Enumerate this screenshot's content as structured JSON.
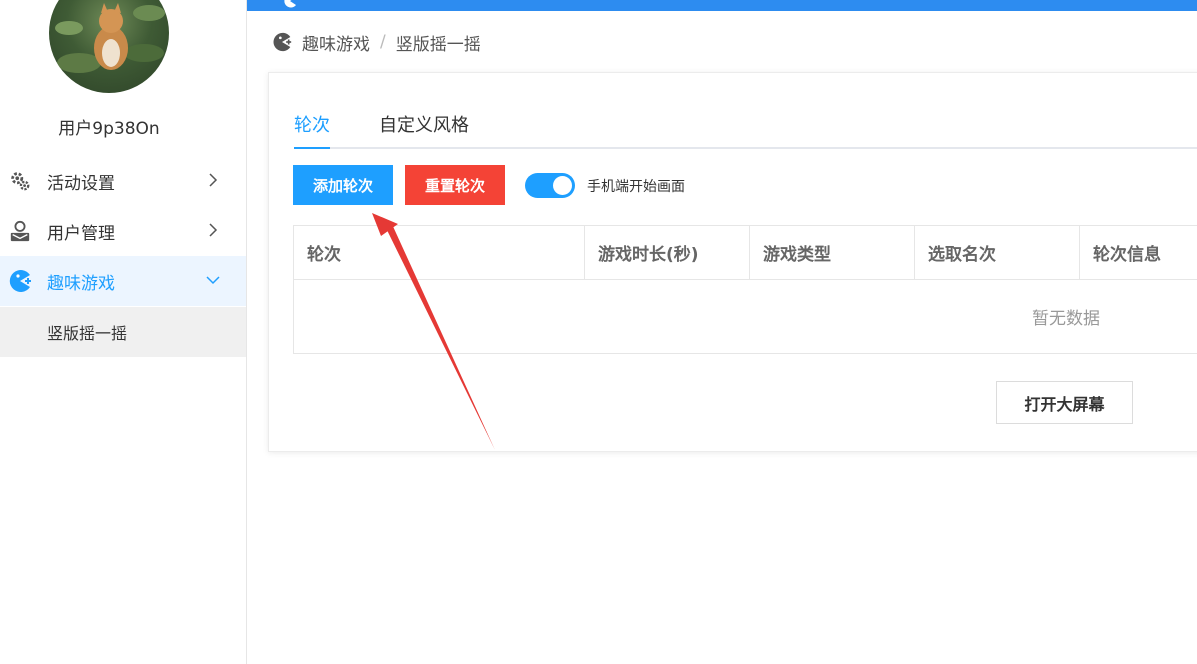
{
  "sidebar": {
    "username": "用户9p38On",
    "items": [
      {
        "label": "活动设置",
        "icon": "gears-icon",
        "expanded": false
      },
      {
        "label": "用户管理",
        "icon": "user-icon",
        "expanded": false
      },
      {
        "label": "趣味游戏",
        "icon": "pacman-icon",
        "expanded": true
      }
    ],
    "submenu": [
      {
        "label": "竖版摇一摇"
      }
    ]
  },
  "breadcrumb": {
    "items": [
      "趣味游戏",
      "竖版摇一摇"
    ]
  },
  "tabs": [
    {
      "label": "轮次",
      "active": true
    },
    {
      "label": "自定义风格",
      "active": false
    }
  ],
  "toolbar": {
    "add_label": "添加轮次",
    "reset_label": "重置轮次",
    "switch_label": "手机端开始画面",
    "switch_on": true
  },
  "table": {
    "columns": [
      "轮次",
      "游戏时长(秒)",
      "游戏类型",
      "选取名次",
      "轮次信息"
    ],
    "empty_text": "暂无数据"
  },
  "footer": {
    "open_screen_label": "打开大屏幕"
  },
  "colors": {
    "accent": "#1e9fff",
    "danger": "#f44336",
    "topbar": "#2d8cf0"
  }
}
